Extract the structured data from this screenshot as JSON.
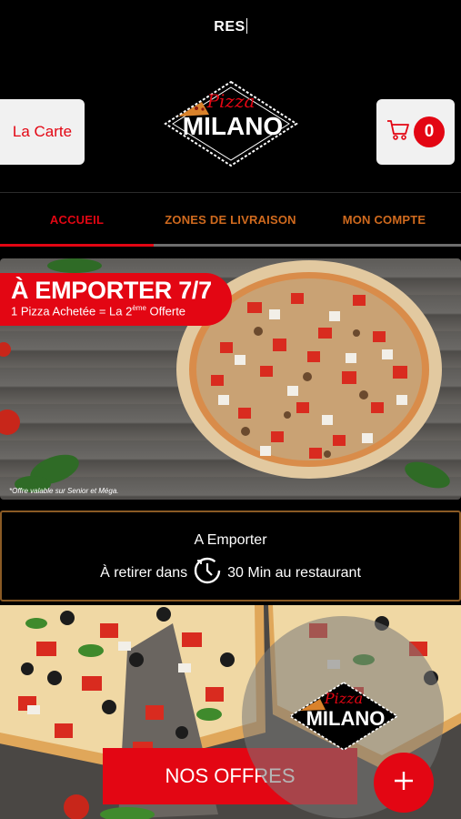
{
  "top_bar": {
    "typed_text": "RES"
  },
  "header": {
    "carte_button": "La Carte",
    "logo_script": "Pizza",
    "logo_word": "MILANO",
    "cart_count": "0"
  },
  "nav": {
    "items": [
      {
        "label": "ACCUEIL",
        "active": true
      },
      {
        "label": "ZONES DE LIVRAISON",
        "active": false
      },
      {
        "label": "MON COMPTE",
        "active": false
      }
    ]
  },
  "banner": {
    "title": "À EMPORTER 7/7",
    "subtitle_prefix": "1 Pizza Achetée = La 2",
    "subtitle_sup": "ème",
    "subtitle_suffix": " Offerte",
    "note": "*Offre valable sur Senior et Méga."
  },
  "pickup": {
    "title": "A Emporter",
    "line_before": "À retirer dans",
    "line_after": "30 Min au restaurant"
  },
  "offers": {
    "button_label": "NOS OFFRES"
  },
  "colors": {
    "brand_red": "#e30613",
    "nav_orange": "#d06a1e",
    "border_brown": "#8a5a24"
  },
  "icons": {
    "cart": "shopping-cart-icon",
    "clock": "clock-icon",
    "plus": "plus-icon"
  }
}
